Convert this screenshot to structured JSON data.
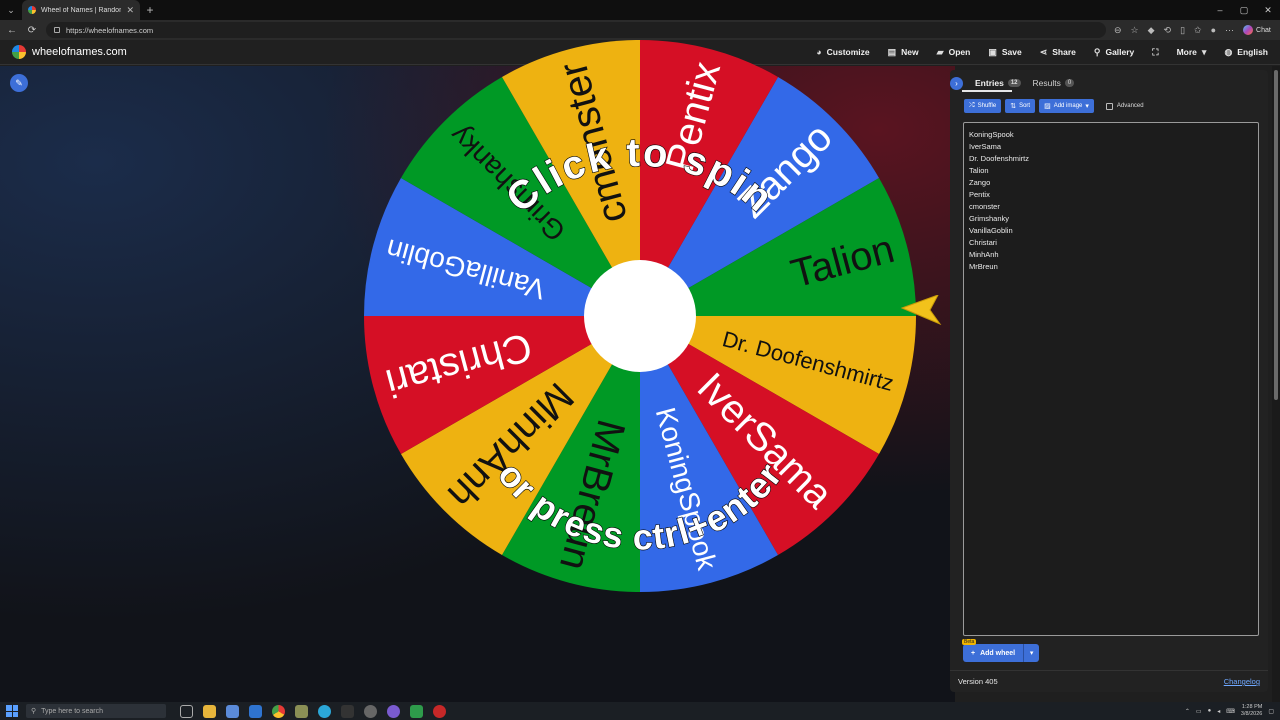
{
  "browser": {
    "tab_title": "Wheel of Names | Random name",
    "url": "https://wheelofnames.com",
    "chat_label": "Chat"
  },
  "app": {
    "site_name": "wheelofnames.com",
    "menu": [
      {
        "label": "Customize",
        "icon": "palette-icon"
      },
      {
        "label": "New",
        "icon": "file-icon"
      },
      {
        "label": "Open",
        "icon": "folder-icon"
      },
      {
        "label": "Save",
        "icon": "save-icon"
      },
      {
        "label": "Share",
        "icon": "share-icon"
      },
      {
        "label": "Gallery",
        "icon": "search-icon"
      },
      {
        "label": "",
        "icon": "fullscreen-icon"
      },
      {
        "label": "More",
        "icon": "chevron-down-icon"
      },
      {
        "label": "English",
        "icon": "globe-icon"
      }
    ]
  },
  "wheel": {
    "spin_top": "Click to spin",
    "spin_bottom": "or press ctrl+enter",
    "colors": [
      "#3369e8",
      "#009925",
      "#eeb211",
      "#d50f25"
    ],
    "slices": [
      "Zango",
      "Talion",
      "Dr. Doofenshmirtz",
      "IverSama",
      "KoningSpook",
      "MrBreun",
      "MinhAnh",
      "Christari",
      "VanillaGoblin",
      "Grimshanky",
      "cmonster",
      "Pentix"
    ],
    "slice_colors": [
      "#3369e8",
      "#009925",
      "#eeb211",
      "#d50f25",
      "#3369e8",
      "#009925",
      "#eeb211",
      "#d50f25",
      "#3369e8",
      "#009925",
      "#eeb211",
      "#d50f25"
    ]
  },
  "panel": {
    "tab_entries": "Entries",
    "entries_count": "12",
    "tab_results": "Results",
    "results_count": "0",
    "shuffle": "Shuffle",
    "sort": "Sort",
    "add_image": "Add image",
    "advanced": "Advanced",
    "entries": [
      "KoningSpook",
      "IverSama",
      "Dr. Doofenshmirtz",
      "Talion",
      "Zango",
      "Pentix",
      "cmonster",
      "Grimshanky",
      "VanillaGoblin",
      "Christari",
      "MinhAnh",
      "MrBreun"
    ],
    "beta": "Beta",
    "add_wheel": "Add wheel",
    "version": "Version 405",
    "changelog": "Changelog"
  },
  "taskbar": {
    "search_placeholder": "Type here to search",
    "time": "1:28 PM",
    "date": "3/8/2026"
  }
}
